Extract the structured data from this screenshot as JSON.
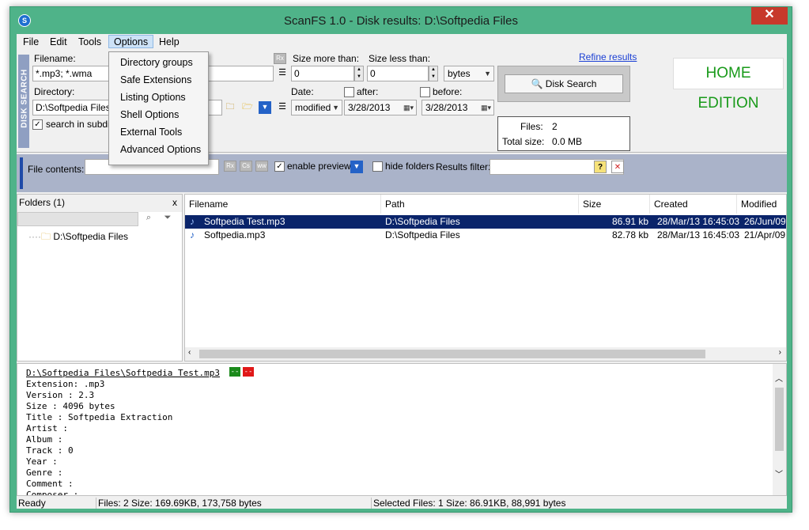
{
  "window": {
    "title": "ScanFS 1.0 - Disk results: D:\\Softpedia Files",
    "close_glyph": "✕"
  },
  "menubar": {
    "items": [
      "File",
      "Edit",
      "Tools",
      "Options",
      "Help"
    ]
  },
  "options_menu": {
    "items": [
      "Directory groups",
      "Safe Extensions",
      "Listing Options",
      "Shell Options",
      "External Tools",
      "Advanced Options"
    ]
  },
  "disk_search": {
    "tab_label": "DISK SEARCH",
    "filename_label": "Filename:",
    "filename_value": "*.mp3; *.wma",
    "directory_label": "Directory:",
    "directory_value": "D:\\Softpedia Files",
    "search_subdirs_label": "search in subdire",
    "search_subdirs_checked": true,
    "regex_button": "Rx",
    "size_more_label": "Size more than:",
    "size_more_value": "0",
    "size_less_label": "Size less than:",
    "size_less_value": "0",
    "size_unit": "bytes",
    "date_label": "Date:",
    "date_field": "modified",
    "after_label": "after:",
    "after_checked": false,
    "after_value": "3/28/2013",
    "before_label": "before:",
    "before_checked": false,
    "before_value": "3/28/2013",
    "refine_results": "Refine results",
    "disk_search_button": "Disk Search",
    "edition": "HOME EDITION",
    "files_label": "Files:",
    "files_value": "2",
    "total_size_label": "Total size:",
    "total_size_value": "0.0 MB"
  },
  "contents_bar": {
    "file_contents_label": "File contents:",
    "file_contents_value": "",
    "rx_button": "Rx",
    "cs_button": "Cs",
    "ww_button": "ww",
    "enable_preview_label": "enable preview",
    "enable_preview_checked": true,
    "hide_folders_label": "hide folders",
    "hide_folders_checked": false,
    "results_filter_label": "Results filter:",
    "results_filter_value": ""
  },
  "folders": {
    "title": "Folders (1)",
    "close": "x",
    "tree": [
      "D:\\Softpedia Files"
    ]
  },
  "files": {
    "columns": [
      "Filename",
      "Path",
      "Size",
      "Created",
      "Modified"
    ],
    "rows": [
      {
        "name": "Softpedia Test.mp3",
        "path": "D:\\Softpedia Files",
        "size": "86.91 kb",
        "created": "28/Mar/13 16:45:03",
        "modified": "26/Jun/09",
        "selected": true
      },
      {
        "name": "Softpedia.mp3",
        "path": "D:\\Softpedia Files",
        "size": "82.78 kb",
        "created": "28/Mar/13 16:45:03",
        "modified": "21/Apr/09",
        "selected": false
      }
    ]
  },
  "preview": {
    "path": "D:\\Softpedia Files\\Softpedia Test.mp3",
    "btn_green": "--",
    "btn_red": "--",
    "lines": [
      "Extension: .mp3",
      "Version : 2.3",
      "Size : 4096 bytes",
      "Title : Softpedia Extraction",
      "Artist :",
      "Album :",
      "Track : 0",
      "Year :",
      "Genre :",
      "Comment :",
      "Composer :"
    ]
  },
  "status": {
    "ready": "Ready",
    "files": "Files: 2 Size: 169.69KB, 173,758 bytes",
    "selected": "Selected Files: 1 Size: 86.91KB, 88,991 bytes"
  },
  "colors": {
    "window_frame": "#4fb389",
    "selection": "#0a246a",
    "edition_green": "#199a1a",
    "link": "#1a3fd4"
  }
}
